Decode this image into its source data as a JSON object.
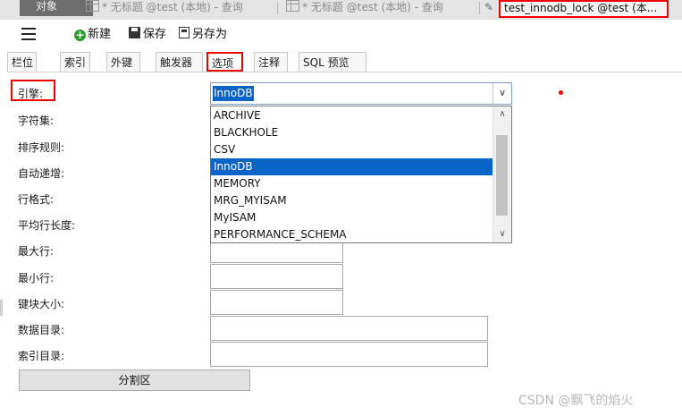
{
  "doc_tabs": {
    "objects": "对象",
    "query1": "* 无标题 @test (本地) - 查询",
    "query2": "* 无标题 @test (本地) - 查询",
    "active": "test_innodb_lock @test (本..."
  },
  "toolbar": {
    "new_label": "新建",
    "save_label": "保存",
    "saveas_label": "另存为"
  },
  "subtabs": [
    "栏位",
    "索引",
    "外键",
    "触发器",
    "选项",
    "注释",
    "SQL 预览"
  ],
  "active_subtab": "选项",
  "form": {
    "engine_label": "引擎:",
    "charset_label": "字符集:",
    "collation_label": "排序规则:",
    "auto_increment_label": "自动递增:",
    "row_format_label": "行格式:",
    "avg_row_length_label": "平均行长度:",
    "max_rows_label": "最大行:",
    "min_rows_label": "最小行:",
    "key_block_size_label": "键块大小:",
    "data_directory_label": "数据目录:",
    "index_directory_label": "索引目录:",
    "engine_value": "InnoDB",
    "partition_button": "分割区"
  },
  "engine_options": [
    "ARCHIVE",
    "BLACKHOLE",
    "CSV",
    "InnoDB",
    "MEMORY",
    "MRG_MYISAM",
    "MyISAM",
    "PERFORMANCE_SCHEMA"
  ],
  "selected_option": "InnoDB",
  "watermark": "CSDN @飘飞的焰火",
  "colors": {
    "highlight": "#0a64c8",
    "annotation_red": "#ee0000"
  }
}
